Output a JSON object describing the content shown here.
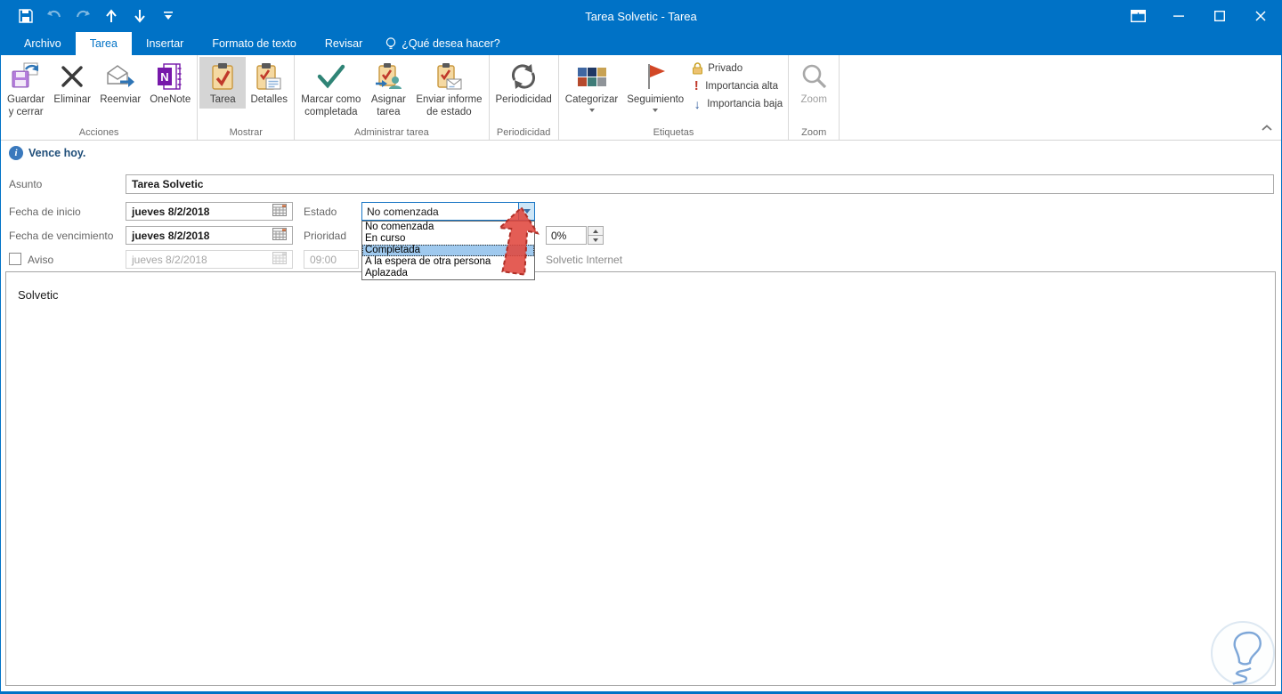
{
  "colors": {
    "titlebar": "#0072C6",
    "accent": "#1976C5",
    "selection": "#9FC9EE",
    "annotation_arrow": "#E0473D"
  },
  "titlebar": {
    "title": "Tarea Solvetic  -  Tarea"
  },
  "tabs": {
    "items": [
      {
        "label": "Archivo"
      },
      {
        "label": "Tarea"
      },
      {
        "label": "Insertar"
      },
      {
        "label": "Formato de texto"
      },
      {
        "label": "Revisar"
      }
    ],
    "selected": "Tarea",
    "help_label": "¿Qué desea hacer?"
  },
  "ribbon": {
    "groups": [
      {
        "label": "Acciones",
        "buttons": [
          {
            "label": "Guardar\ny cerrar"
          },
          {
            "label": "Eliminar"
          },
          {
            "label": "Reenviar"
          },
          {
            "label": "OneNote"
          }
        ]
      },
      {
        "label": "Mostrar",
        "buttons": [
          {
            "label": "Tarea"
          },
          {
            "label": "Detalles"
          }
        ]
      },
      {
        "label": "Administrar tarea",
        "buttons": [
          {
            "label": "Marcar como\ncompletada"
          },
          {
            "label": "Asignar\ntarea"
          },
          {
            "label": "Enviar informe\nde estado"
          }
        ]
      },
      {
        "label": "Periodicidad",
        "buttons": [
          {
            "label": "Periodicidad"
          }
        ]
      },
      {
        "label": "Etiquetas",
        "buttons": [
          {
            "label": "Categorizar"
          },
          {
            "label": "Seguimiento"
          }
        ],
        "small_buttons": [
          {
            "label": "Privado"
          },
          {
            "label": "Importancia alta"
          },
          {
            "label": "Importancia baja"
          }
        ]
      },
      {
        "label": "Zoom",
        "buttons": [
          {
            "label": "Zoom"
          }
        ]
      }
    ]
  },
  "infobar": {
    "text": "Vence hoy."
  },
  "form": {
    "asunto_label": "Asunto",
    "asunto_value": "Tarea Solvetic",
    "fecha_inicio_label": "Fecha de inicio",
    "fecha_inicio_value": "jueves 8/2/2018",
    "estado_label": "Estado",
    "estado_value": "No comenzada",
    "fecha_vencimiento_label": "Fecha de vencimiento",
    "fecha_vencimiento_value": "jueves 8/2/2018",
    "prioridad_label": "Prioridad",
    "aviso_label": "Aviso",
    "aviso_fecha_value": "jueves 8/2/2018",
    "aviso_hora_value": "09:00",
    "percent_value": "0%",
    "owner_text": "Solvetic Internet"
  },
  "estado_dropdown": {
    "options": [
      "No comenzada",
      "En curso",
      "Completada",
      "A la espera de otra persona",
      "Aplazada"
    ],
    "highlighted": "Completada"
  },
  "body": {
    "text": "Solvetic"
  }
}
